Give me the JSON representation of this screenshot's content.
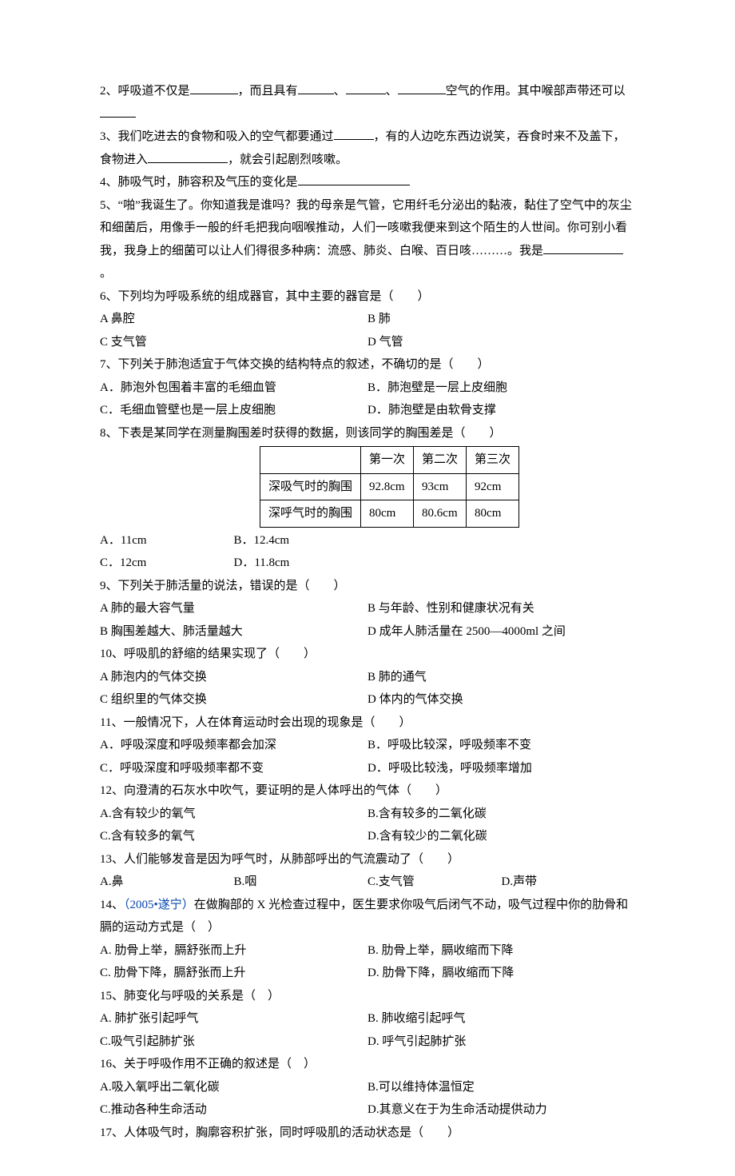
{
  "q2": {
    "pre": "2、呼吸道不仅是",
    "mid1": "，而且具有",
    "mid2": "、",
    "mid3": "、",
    "mid4": "空气的作用。其中喉部声带还可以"
  },
  "q3": {
    "t1": "3、我们吃进去的食物和吸入的空气都要通过",
    "t2": "，有的人边吃东西边说笑，吞食时来不及盖下，食物进入",
    "t3": "，就会引起剧烈咳嗽。"
  },
  "q4": {
    "t1": "4、肺吸气时，肺容积及气压的变化是"
  },
  "q5": {
    "t1": "5、“啪”我诞生了。你知道我是谁吗？我的母亲是气管，它用纤毛分泌出的黏液，黏住了空气中的灰尘和细菌后，用像手一般的纤毛把我向咽喉推动，人们一咳嗽我便来到这个陌生的人世间。你可别小看我，我身上的细菌可以让人们得很多种病：流感、肺炎、白喉、百日咳………。我是",
    "t2": "。"
  },
  "q6": {
    "stem": "6、下列均为呼吸系统的组成器官，其中主要的器官是（　　）",
    "A": "A 鼻腔",
    "B": "B 肺",
    "C": "C 支气管",
    "D": "D 气管"
  },
  "q7": {
    "stem": "7、下列关于肺泡适宜于气体交换的结构特点的叙述，不确切的是（　　）",
    "A": "A．肺泡外包围着丰富的毛细血管",
    "B": "B．肺泡壁是一层上皮细胞",
    "C": "C．毛细血管壁也是一层上皮细胞",
    "D": "D．肺泡壁是由软骨支撑"
  },
  "q8": {
    "stem": "8、下表是某同学在测量胸围差时获得的数据，则该同学的胸围差是（　　）",
    "A": "A．11cm",
    "B": "B．12.4cm",
    "C": "C．12cm",
    "D": "D．11.8cm"
  },
  "chart_data": {
    "type": "table",
    "columns": [
      "",
      "第一次",
      "第二次",
      "第三次"
    ],
    "rows": [
      {
        "label": "深吸气时的胸围",
        "values": [
          "92.8cm",
          "93cm",
          "92cm"
        ]
      },
      {
        "label": "深呼气时的胸围",
        "values": [
          "80cm",
          "80.6cm",
          "80cm"
        ]
      }
    ]
  },
  "q9": {
    "stem": "9、下列关于肺活量的说法，错误的是（　　）",
    "A": "A 肺的最大容气量",
    "B": "B 与年龄、性别和健康状况有关",
    "C": "B 胸围差越大、肺活量越大",
    "D": "D 成年人肺活量在 2500—4000ml 之间"
  },
  "q10": {
    "stem": "10、呼吸肌的舒缩的结果实现了（　　）",
    "A": "A 肺泡内的气体交换",
    "B": "B 肺的通气",
    "C": "C 组织里的气体交换",
    "D": "D 体内的气体交换"
  },
  "q11": {
    "stem": "11、一般情况下，人在体育运动时会出现的现象是（　　）",
    "A": "A．呼吸深度和呼吸频率都会加深",
    "B": "B．呼吸比较深，呼吸频率不变",
    "C": "C．呼吸深度和呼吸频率都不变",
    "D": "D．呼吸比较浅，呼吸频率增加"
  },
  "q12": {
    "stem": "12、向澄清的石灰水中吹气，要证明的是人体呼出的气体（　　）",
    "A": "A.含有较少的氧气",
    "B": "B.含有较多的二氧化碳",
    "C": "C.含有较多的氧气",
    "D": "D.含有较少的二氧化碳"
  },
  "q13": {
    "stem": "13、人们能够发音是因为呼气时，从肺部呼出的气流震动了（　　）",
    "A": "A.鼻",
    "B": "B.咽",
    "C": "C.支气管",
    "D": "D.声带"
  },
  "q14": {
    "pre": "14、",
    "linklabel": "（2005•遂宁）",
    "stem": "在做胸部的 X 光检查过程中，医生要求你吸气后闭气不动，吸气过程中你的肋骨和膈的运动方式是（　）",
    "A": "A. 肋骨上举，膈舒张而上升",
    "B": "B. 肋骨上举，膈收缩而下降",
    "C": "C. 肋骨下降，膈舒张而上升",
    "D": "D. 肋骨下降，膈收缩而下降"
  },
  "q15": {
    "stem": "15、肺变化与呼吸的关系是（　）",
    "A": "A. 肺扩张引起呼气",
    "B": "B. 肺收缩引起呼气",
    "C": "C.吸气引起肺扩张",
    "D": "D. 呼气引起肺扩张"
  },
  "q16": {
    "stem": "16、关于呼吸作用不正确的叙述是（　）",
    "A": "A.吸入氧呼出二氧化碳",
    "B": "B.可以维持体温恒定",
    "C": "C.推动各种生命活动",
    "D": "D.其意义在于为生命活动提供动力"
  },
  "q17": {
    "stem": "17、人体吸气时，胸廓容积扩张，同时呼吸肌的活动状态是（　　）"
  }
}
